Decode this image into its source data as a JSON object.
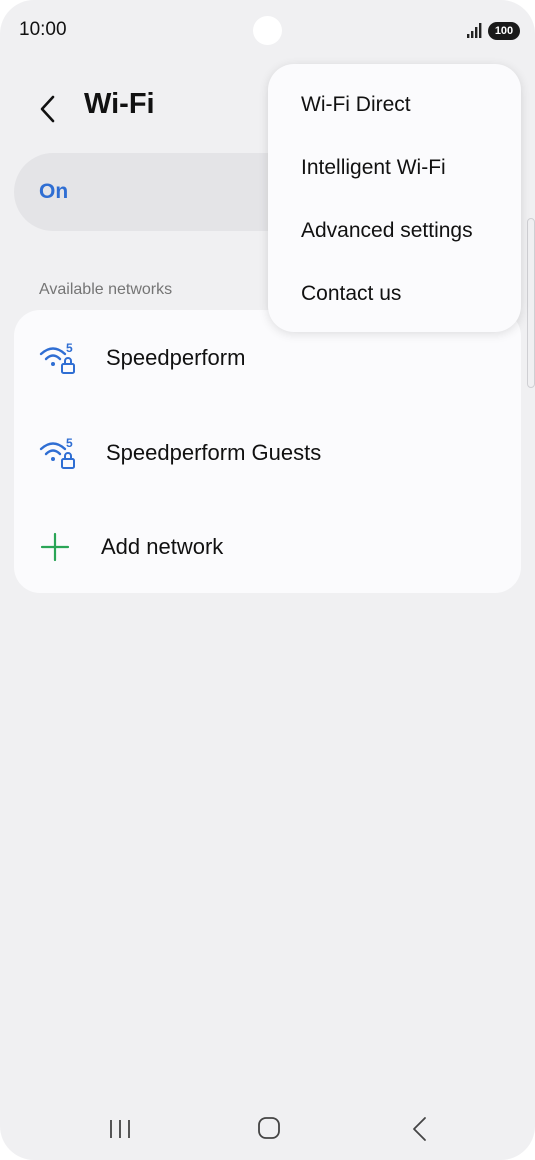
{
  "status_bar": {
    "time": "10:00",
    "battery": "100"
  },
  "header": {
    "title": "Wi-Fi"
  },
  "master_switch": {
    "label": "On"
  },
  "available_networks": {
    "section_label": "Available networks",
    "networks": [
      {
        "name": "Speedperform",
        "icon": "wifi-5ghz-locked-icon"
      },
      {
        "name": "Speedperform Guests",
        "icon": "wifi-5ghz-locked-icon"
      }
    ],
    "add_network_label": "Add network",
    "wifi_badge": "5"
  },
  "overflow_menu": {
    "items": [
      "Wi-Fi Direct",
      "Intelligent Wi-Fi",
      "Advanced settings",
      "Contact us"
    ]
  },
  "nav_bar": {
    "icons": [
      "recents-icon",
      "home-icon",
      "back-icon"
    ]
  },
  "colors": {
    "accent": "#2f6ed3",
    "add_icon": "#2aa556",
    "background": "#f0f0f2",
    "card": "#fbfbfd"
  }
}
